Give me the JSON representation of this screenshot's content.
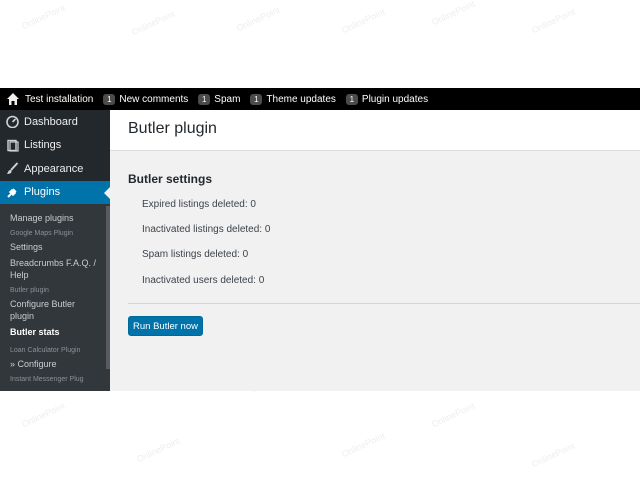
{
  "topbar": {
    "site_name": "Test installation",
    "items": [
      {
        "count": "1",
        "label": "New comments"
      },
      {
        "count": "1",
        "label": "Spam"
      },
      {
        "count": "1",
        "label": "Theme updates"
      },
      {
        "count": "1",
        "label": "Plugin updates"
      }
    ]
  },
  "sidebar": {
    "menu": [
      {
        "label": "Dashboard",
        "icon": "dashboard-icon"
      },
      {
        "label": "Listings",
        "icon": "listings-icon"
      },
      {
        "label": "Appearance",
        "icon": "brush-icon"
      },
      {
        "label": "Plugins",
        "icon": "plug-icon"
      }
    ],
    "submenu": {
      "manage_plugins": "Manage plugins",
      "google_maps_head": "Google Maps Plugin",
      "settings": "Settings",
      "breadcrumbs": "Breadcrumbs F.A.Q. / Help",
      "butler_head": "Butler plugin",
      "configure_butler": "Configure Butler plugin",
      "butler_stats": "Butler stats",
      "loan_head": "Loan Calculator Plugin",
      "configure": "» Configure",
      "instant_head": "Instant Messenger Plug"
    }
  },
  "main": {
    "page_title": "Butler plugin",
    "section_title": "Butler settings",
    "stats": [
      "Expired listings deleted: 0",
      "Inactivated listings deleted: 0",
      "Spam listings deleted: 0",
      "Inactivated users deleted: 0"
    ],
    "run_button": "Run Butler now"
  },
  "colors": {
    "accent": "#0073aa",
    "sidebar_bg": "#23282d",
    "submenu_bg": "#32373c",
    "topbar_bg": "#000000"
  }
}
